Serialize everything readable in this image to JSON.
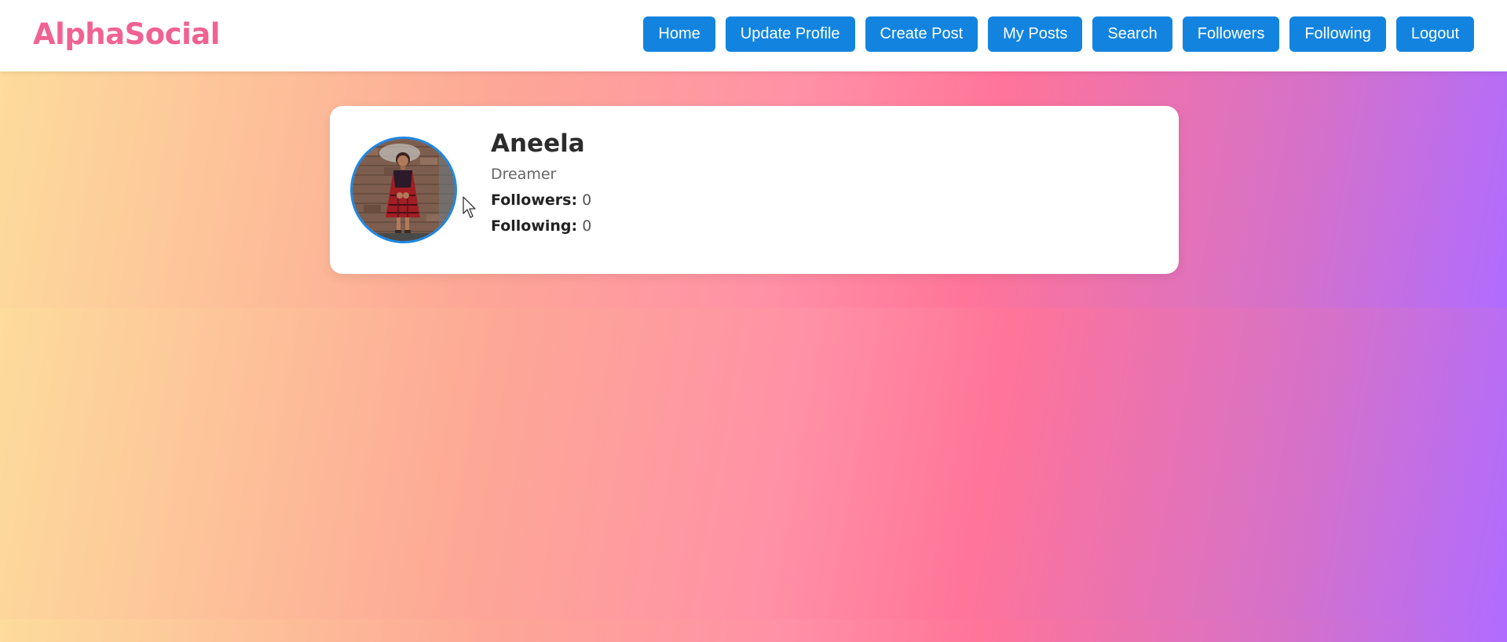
{
  "brand": "AlphaSocial",
  "nav": [
    {
      "label": "Home",
      "name": "nav-home-button"
    },
    {
      "label": "Update Profile",
      "name": "nav-update-profile-button"
    },
    {
      "label": "Create Post",
      "name": "nav-create-post-button"
    },
    {
      "label": "My Posts",
      "name": "nav-my-posts-button"
    },
    {
      "label": "Search",
      "name": "nav-search-button"
    },
    {
      "label": "Followers",
      "name": "nav-followers-button"
    },
    {
      "label": "Following",
      "name": "nav-following-button"
    },
    {
      "label": "Logout",
      "name": "nav-logout-button"
    }
  ],
  "profile": {
    "name": "Aneela",
    "bio": "Dreamer",
    "followers_label": "Followers:",
    "followers_count": "0",
    "following_label": "Following:",
    "following_count": "0"
  },
  "colors": {
    "brand": "#f06292",
    "button": "#1284e0",
    "avatar_border": "#1e88e5"
  },
  "icons": {
    "cursor": "mouse-pointer-icon"
  }
}
